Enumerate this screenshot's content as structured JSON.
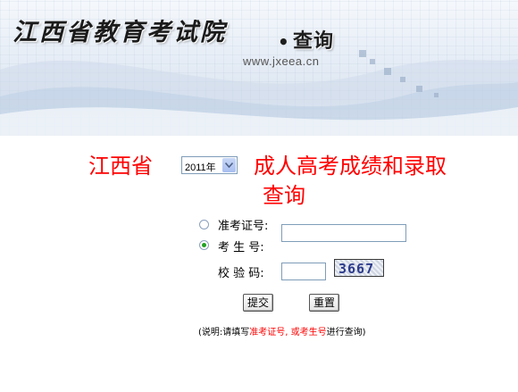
{
  "banner": {
    "title": "江西省教育考试院",
    "dot": "•",
    "query": "查询",
    "url": "www.jxeea.cn"
  },
  "heading": {
    "province": "江西省",
    "title": "成人高考成绩和录取",
    "title_line2": "查询"
  },
  "year_select": {
    "value": "2011年"
  },
  "form": {
    "option_exam_cert": "准考证号:",
    "option_exam_no": "考 生 号:",
    "option_exam_no_selected": true,
    "captcha_label": "校 验 码:",
    "captcha_text": "3667",
    "submit_label": "提交",
    "reset_label": "重置"
  },
  "note": {
    "prefix": "(说明:请填写",
    "highlight": "准考证号, 或考生号",
    "suffix": "进行查询)"
  }
}
